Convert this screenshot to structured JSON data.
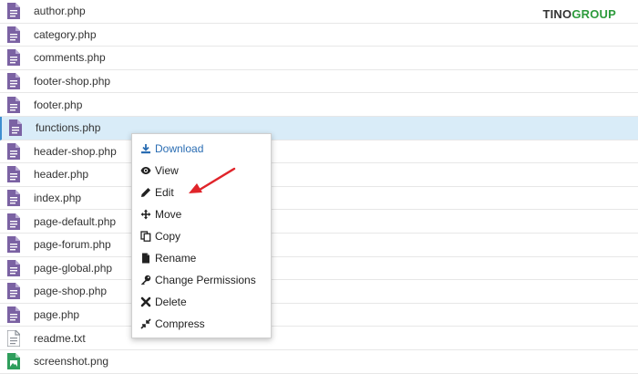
{
  "brand": {
    "part1": "TINO",
    "part2": "GROUP"
  },
  "files": [
    {
      "name": "author.php",
      "type": "php"
    },
    {
      "name": "category.php",
      "type": "php"
    },
    {
      "name": "comments.php",
      "type": "php"
    },
    {
      "name": "footer-shop.php",
      "type": "php"
    },
    {
      "name": "footer.php",
      "type": "php"
    },
    {
      "name": "functions.php",
      "type": "php",
      "selected": true
    },
    {
      "name": "header-shop.php",
      "type": "php"
    },
    {
      "name": "header.php",
      "type": "php"
    },
    {
      "name": "index.php",
      "type": "php"
    },
    {
      "name": "page-default.php",
      "type": "php"
    },
    {
      "name": "page-forum.php",
      "type": "php"
    },
    {
      "name": "page-global.php",
      "type": "php"
    },
    {
      "name": "page-shop.php",
      "type": "php"
    },
    {
      "name": "page.php",
      "type": "php"
    },
    {
      "name": "readme.txt",
      "type": "txt"
    },
    {
      "name": "screenshot.png",
      "type": "png"
    }
  ],
  "context_menu": {
    "items": [
      {
        "label": "Download",
        "icon": "download-icon"
      },
      {
        "label": "View",
        "icon": "eye-icon"
      },
      {
        "label": "Edit",
        "icon": "pencil-icon"
      },
      {
        "label": "Move",
        "icon": "move-icon"
      },
      {
        "label": "Copy",
        "icon": "copy-icon"
      },
      {
        "label": "Rename",
        "icon": "file-icon"
      },
      {
        "label": "Change Permissions",
        "icon": "key-icon"
      },
      {
        "label": "Delete",
        "icon": "close-icon"
      },
      {
        "label": "Compress",
        "icon": "compress-icon"
      }
    ]
  },
  "colors": {
    "file_icon_php": "#7b62a3",
    "file_icon_txt": "#8a8f96",
    "file_icon_png": "#2f9e5c",
    "selected_row": "#d9ecf8",
    "menu_primary": "#2a6db3",
    "annotation_arrow": "#e0242a",
    "brand_green": "#2d9b3c"
  }
}
